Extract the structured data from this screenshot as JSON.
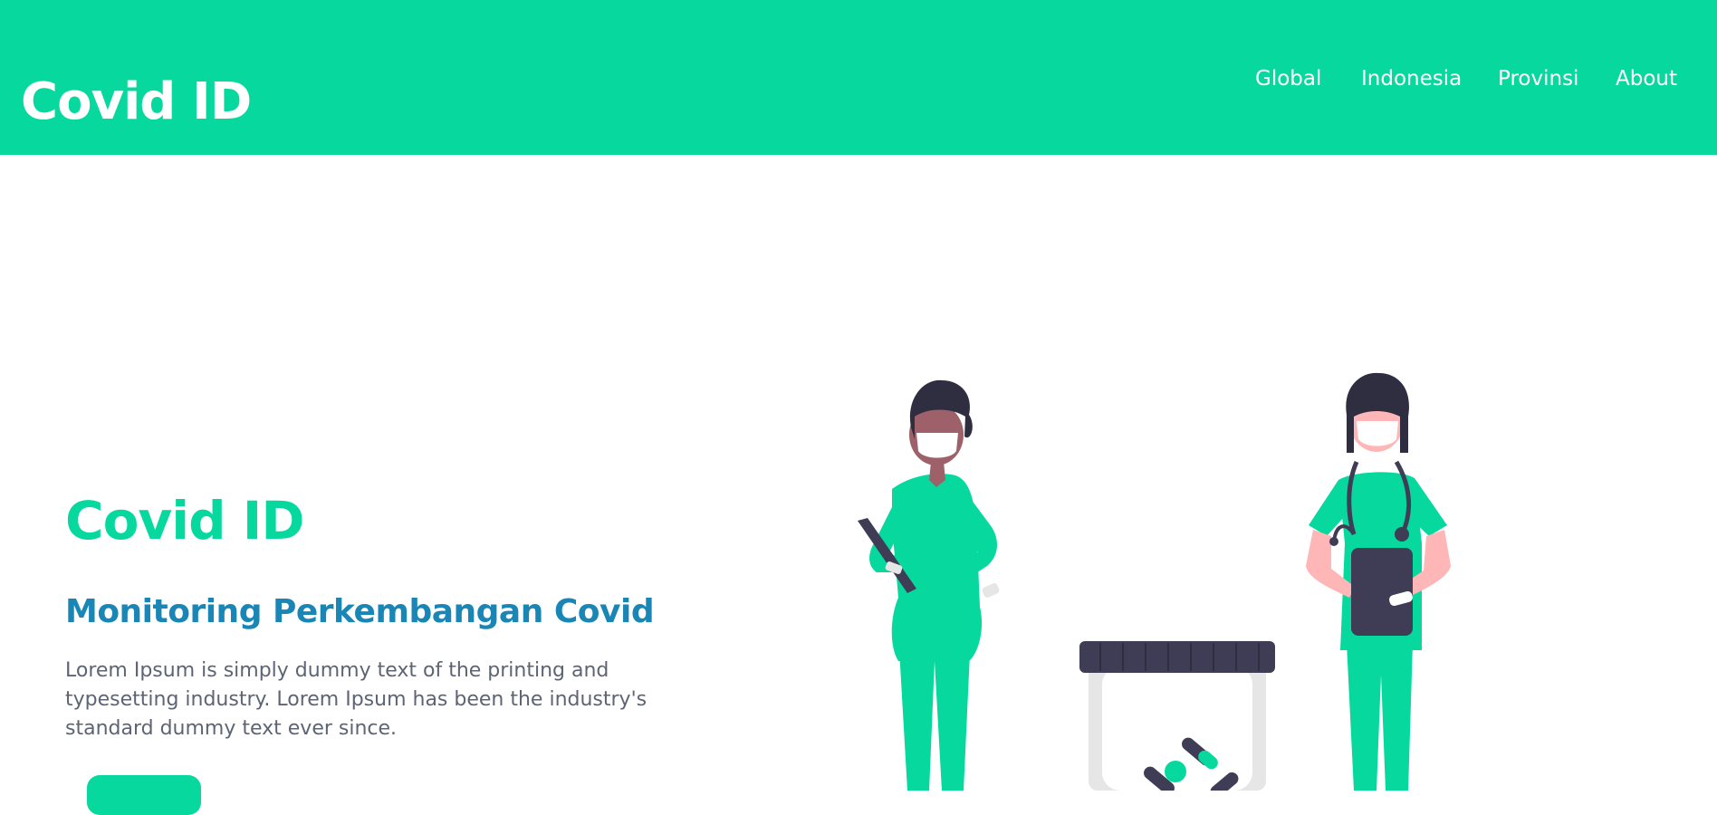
{
  "navbar": {
    "brand": "Covid ID",
    "links": [
      {
        "label": "Global"
      },
      {
        "label": "Indonesia"
      },
      {
        "label": "Provinsi"
      },
      {
        "label": "About"
      }
    ]
  },
  "hero": {
    "title": "Covid ID",
    "subtitle": "Monitoring Perkembangan Covid",
    "description": "Lorem Ipsum is simply dummy text of the printing and typesetting industry. Lorem Ipsum has been the industry's standard dummy text ever since.",
    "button_label": ""
  },
  "illustration": {
    "icon": "doctors-illustration",
    "colors": {
      "scrubs": "#07d89e",
      "hair": "#2f2e41",
      "skin_dark": "#9e616a",
      "skin_light": "#ffb6b6",
      "mask": "#ffffff",
      "jar": "#e6e6e6"
    }
  },
  "colors": {
    "accent": "#07d89e",
    "subtitle": "#1a86b6",
    "body_text": "#5d6473"
  }
}
